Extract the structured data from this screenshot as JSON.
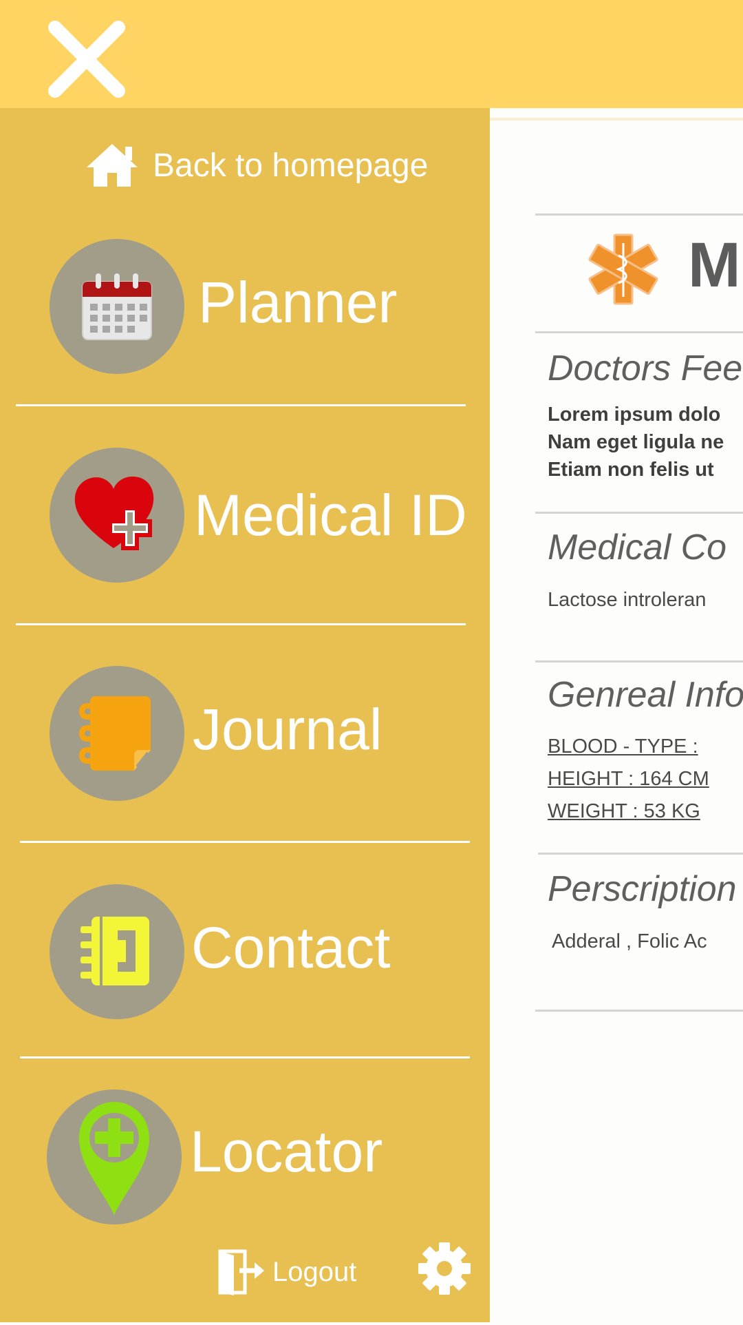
{
  "header": {
    "close_icon": "close-icon"
  },
  "drawer": {
    "home_label": "Back to homepage",
    "items": [
      {
        "label": "Planner",
        "icon": "calendar-icon"
      },
      {
        "label": "Medical ID",
        "icon": "heart-plus-icon"
      },
      {
        "label": "Journal",
        "icon": "notebook-icon"
      },
      {
        "label": "Contact",
        "icon": "address-book-icon"
      },
      {
        "label": "Locator",
        "icon": "location-pin-plus-icon"
      }
    ],
    "logout_label": "Logout",
    "settings_icon": "gear-icon"
  },
  "content": {
    "title": "M",
    "sections": {
      "feedback": {
        "heading": "Doctors Fee",
        "lines": [
          "Lorem ipsum dolo",
          "Nam eget ligula ne",
          "Etiam non felis ut"
        ]
      },
      "conditions": {
        "heading": "Medical Co",
        "text": "Lactose introleran"
      },
      "general": {
        "heading": "Genreal Info",
        "lines": [
          "BLOOD - TYPE :  ",
          "HEIGHT : 164 CM",
          "WEIGHT : 53 KG  "
        ]
      },
      "prescriptions": {
        "heading": "Perscription",
        "text": "Adderal , Folic Ac"
      }
    }
  },
  "colors": {
    "topbar": "#ffd462",
    "drawer": "#e8c051",
    "circle": "#a29d89",
    "text_light": "#ffffff"
  }
}
